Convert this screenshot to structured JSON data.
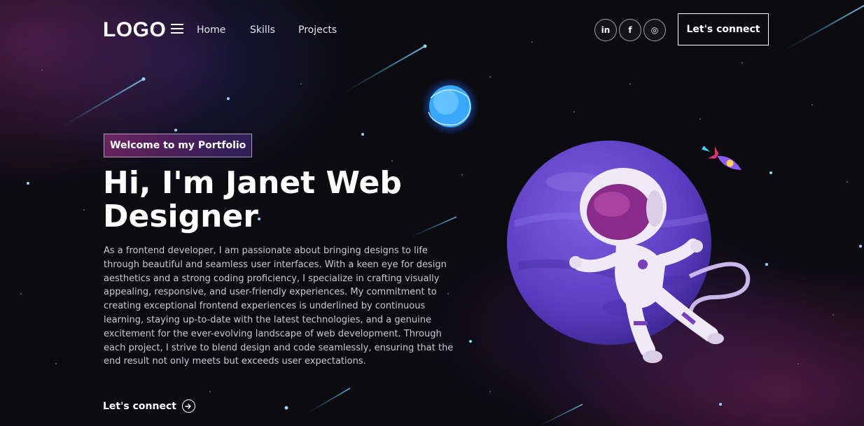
{
  "brand": {
    "logo_text": "LOGO"
  },
  "nav": {
    "items": [
      "Home",
      "Skills",
      "Projects"
    ]
  },
  "social": [
    {
      "label": "in",
      "icon": "linkedin-icon"
    },
    {
      "label": "f",
      "icon": "facebook-icon"
    },
    {
      "label": "◎",
      "icon": "instagram-icon"
    }
  ],
  "header": {
    "connect_label": "Let's connect"
  },
  "hero": {
    "tagline": "Welcome to my Portfolio",
    "title": "Hi, I'm Janet Web Designer",
    "description": "As a frontend developer, I am passionate about bringing designs to life through beautiful and seamless user interfaces. With a keen eye for design aesthetics and a strong coding proficiency, I specialize in crafting visually appealing, responsive, and user-friendly experiences. My commitment to creating exceptional frontend experiences is underlined by continuous learning, staying up-to-date with the latest technologies, and a genuine excitement for the ever-evolving landscape of web development. Through each project, I strive to blend design and code seamlessly, ensuring that the end result not only meets but exceeds user expectations.",
    "cta_label": "Let's connect"
  },
  "colors": {
    "accent": "#7b3fbf",
    "planet": "#6b45c8",
    "tag_gradient_start": "#a9338c",
    "background": "#0b0b10"
  }
}
